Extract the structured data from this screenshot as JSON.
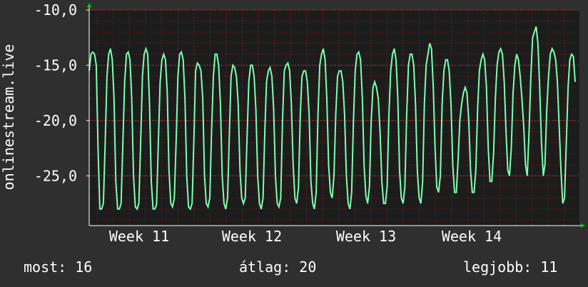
{
  "chart_data": {
    "type": "line",
    "ylabel": "onlinestream.live",
    "y_ticks": [
      "-10,0",
      "-15,0",
      "-20,0",
      "-25,0"
    ],
    "y_tick_values": [
      -10,
      -15,
      -20,
      -25
    ],
    "ylim": [
      -29.5,
      -10
    ],
    "x_ticks": [
      "Week 11",
      "Week 12",
      "Week 13",
      "Week 14"
    ],
    "grid": true,
    "colors": {
      "background": "#2f2f2f",
      "plot_background": "#1c1c1c",
      "grid": "#7a1f1f",
      "line": "#7dffb0",
      "axis": "#ffffff",
      "arrow": "#00cc00"
    },
    "series": [
      {
        "values": [
          -15.5,
          -14.0,
          -13.8,
          -14.0,
          -15.0,
          -22.5,
          -28.0,
          -28.0,
          -27.5,
          -22.0,
          -16.0,
          -14.0,
          -13.5,
          -14.5,
          -18.0,
          -25.5,
          -28.0,
          -28.0,
          -27.5,
          -22.0,
          -16.5,
          -14.0,
          -13.8,
          -14.5,
          -18.0,
          -25.0,
          -27.8,
          -28.0,
          -27.5,
          -22.0,
          -16.0,
          -14.0,
          -13.5,
          -14.0,
          -18.5,
          -25.5,
          -28.0,
          -28.0,
          -27.6,
          -22.0,
          -16.5,
          -14.5,
          -14.0,
          -14.5,
          -17.5,
          -24.5,
          -27.5,
          -27.8,
          -27.0,
          -22.0,
          -16.0,
          -14.0,
          -13.8,
          -14.5,
          -18.0,
          -25.0,
          -27.8,
          -28.0,
          -27.5,
          -22.0,
          -15.5,
          -14.8,
          -15.0,
          -15.5,
          -18.0,
          -25.0,
          -27.5,
          -27.8,
          -27.0,
          -21.0,
          -16.0,
          -14.0,
          -14.0,
          -15.0,
          -18.5,
          -25.0,
          -27.5,
          -28.0,
          -27.0,
          -21.5,
          -16.0,
          -15.0,
          -15.2,
          -16.0,
          -18.5,
          -24.5,
          -27.0,
          -27.5,
          -27.0,
          -21.5,
          -16.5,
          -15.0,
          -15.0,
          -16.0,
          -19.0,
          -25.0,
          -27.5,
          -28.0,
          -27.0,
          -21.0,
          -16.5,
          -15.5,
          -15.2,
          -16.0,
          -19.0,
          -25.0,
          -27.5,
          -27.8,
          -27.0,
          -20.0,
          -15.5,
          -15.0,
          -14.8,
          -15.5,
          -18.5,
          -24.0,
          -27.0,
          -27.5,
          -26.0,
          -19.5,
          -16.0,
          -15.5,
          -15.5,
          -16.5,
          -19.5,
          -25.5,
          -27.5,
          -28.0,
          -26.5,
          -19.5,
          -15.0,
          -14.0,
          -13.5,
          -14.5,
          -18.0,
          -24.0,
          -26.5,
          -27.0,
          -25.0,
          -19.5,
          -16.0,
          -15.5,
          -15.5,
          -16.5,
          -19.5,
          -25.0,
          -27.5,
          -28.0,
          -26.5,
          -20.0,
          -15.5,
          -14.0,
          -13.8,
          -14.5,
          -18.0,
          -24.0,
          -26.8,
          -27.5,
          -26.0,
          -20.0,
          -17.0,
          -16.5,
          -17.0,
          -18.0,
          -21.0,
          -25.5,
          -27.5,
          -27.5,
          -26.0,
          -19.5,
          -15.5,
          -14.0,
          -13.5,
          -14.5,
          -18.0,
          -24.5,
          -27.0,
          -27.5,
          -26.0,
          -19.5,
          -15.0,
          -14.0,
          -14.0,
          -15.0,
          -18.5,
          -24.5,
          -27.0,
          -27.5,
          -25.5,
          -18.5,
          -15.0,
          -14.0,
          -13.0,
          -13.5,
          -17.0,
          -22.5,
          -26.0,
          -26.5,
          -25.0,
          -18.5,
          -15.5,
          -14.5,
          -14.5,
          -15.5,
          -18.5,
          -24.0,
          -26.5,
          -26.5,
          -23.5,
          -20.0,
          -18.5,
          -17.5,
          -17.0,
          -17.5,
          -20.0,
          -24.5,
          -26.5,
          -26.5,
          -24.5,
          -19.0,
          -15.5,
          -14.5,
          -14.0,
          -14.5,
          -17.0,
          -22.5,
          -25.5,
          -25.5,
          -23.0,
          -18.0,
          -15.0,
          -13.8,
          -13.5,
          -14.0,
          -16.5,
          -21.0,
          -24.5,
          -25.0,
          -22.5,
          -17.5,
          -15.0,
          -14.0,
          -14.5,
          -16.0,
          -18.0,
          -20.5,
          -24.0,
          -25.0,
          -21.0,
          -16.0,
          -12.5,
          -12.0,
          -11.5,
          -13.0,
          -17.0,
          -22.0,
          -25.0,
          -24.0,
          -19.0,
          -16.0,
          -14.0,
          -13.5,
          -13.8,
          -14.5,
          -16.5,
          -20.5,
          -24.5,
          -27.5,
          -27.0,
          -22.0,
          -17.0,
          -14.5,
          -14.0,
          -14.2,
          -16.5
        ]
      }
    ]
  },
  "stats": {
    "current": "most: 16",
    "average": "átlag: 20",
    "best": "legjobb: 11"
  }
}
